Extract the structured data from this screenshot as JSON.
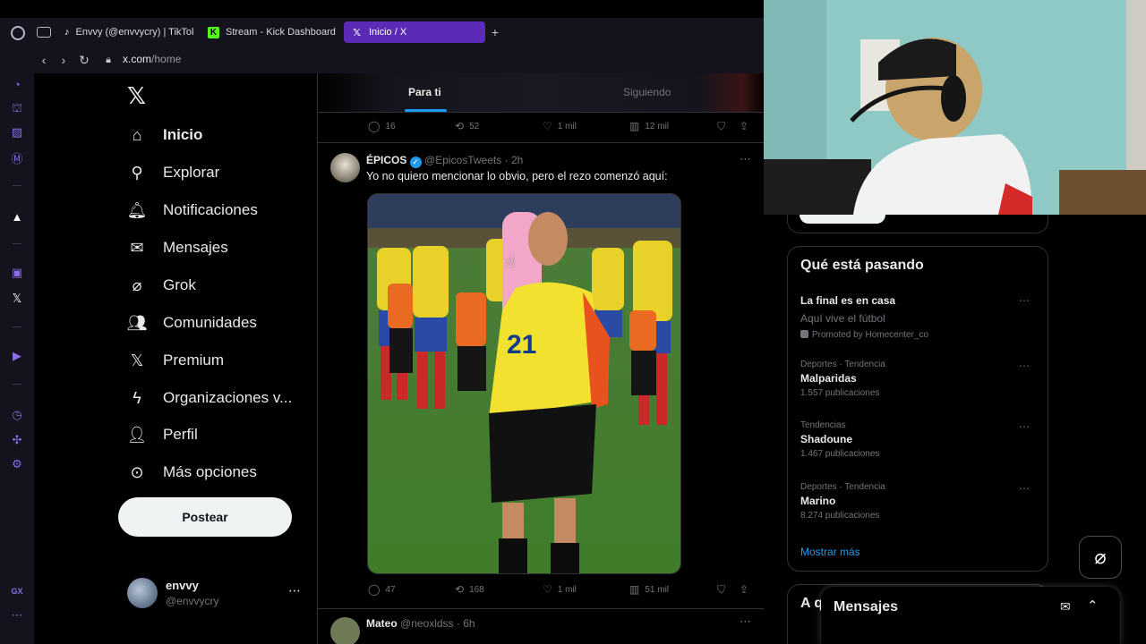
{
  "browser": {
    "tabs": [
      {
        "label": "Envvy (@envvycry) | TikTok",
        "icon": "tiktok-icon"
      },
      {
        "label": "Stream - Kick Dashboard",
        "icon": "kick-icon"
      },
      {
        "label": "Inicio / X",
        "icon": "x-icon"
      }
    ],
    "url_host": "x.com",
    "url_path": "/home",
    "sidebar_gx_label": "GX"
  },
  "nav": {
    "items": [
      {
        "label": "Inicio",
        "icon": "home-icon"
      },
      {
        "label": "Explorar",
        "icon": "search-icon"
      },
      {
        "label": "Notificaciones",
        "icon": "bell-icon"
      },
      {
        "label": "Mensajes",
        "icon": "envelope-icon"
      },
      {
        "label": "Grok",
        "icon": "grok-icon"
      },
      {
        "label": "Comunidades",
        "icon": "people-icon"
      },
      {
        "label": "Premium",
        "icon": "x-icon"
      },
      {
        "label": "Organizaciones v...",
        "icon": "lightning-icon"
      },
      {
        "label": "Perfil",
        "icon": "person-icon"
      },
      {
        "label": "Más opciones",
        "icon": "more-circle-icon"
      }
    ],
    "post_label": "Postear",
    "account_name": "envvy",
    "account_handle": "@envvycry"
  },
  "feed": {
    "tabs": [
      "Para ti",
      "Siguiendo"
    ],
    "prev_tweet_stats": {
      "replies": "16",
      "reposts": "52",
      "likes": "1 mil",
      "views": "12 mil"
    },
    "tweet": {
      "name": "ÉPICOS",
      "handle": "@EpicosTweets",
      "time": "2h",
      "text": "Yo no quiero mencionar lo obvio, pero el rezo comenzó aquí:",
      "jersey_number": "21",
      "stats": {
        "replies": "47",
        "reposts": "168",
        "likes": "1 mil",
        "views": "51 mil"
      }
    },
    "next_tweet": {
      "name": "Mateo",
      "handle": "@neoxldss",
      "time": "6h"
    }
  },
  "trends": {
    "title": "Qué está pasando",
    "promoted": {
      "title": "La final es en casa",
      "subtitle": "Aquí vive el fútbol",
      "promo": "Promoted by Homecenter_co"
    },
    "items": [
      {
        "context": "Deportes · Tendencia",
        "title": "Malparidas",
        "count": "1.557 publicaciones"
      },
      {
        "context": "Tendencias",
        "title": "Shadoune",
        "count": "1.467 publicaciones"
      },
      {
        "context": "Deportes · Tendencia",
        "title": "Marino",
        "count": "8.274 publicaciones"
      }
    ],
    "show_more": "Mostrar más",
    "next_section_start": "A q"
  },
  "messages": {
    "label": "Mensajes"
  },
  "colors": {
    "accent": "#1d9bf0",
    "tab_active": "#5b2bb8",
    "opera_icon": "#8a6ee8"
  }
}
